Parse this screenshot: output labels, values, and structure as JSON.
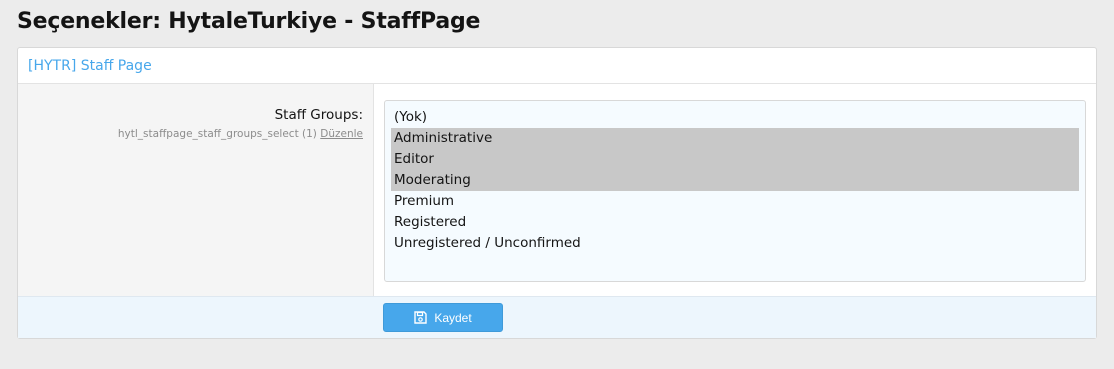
{
  "page": {
    "title": "Seçenekler: HytaleTurkiye - StaffPage"
  },
  "block": {
    "header_title": "[HYTR] Staff Page"
  },
  "field": {
    "label": "Staff Groups:",
    "hint_id": "hytl_staffpage_staff_groups_select (1)",
    "hint_edit_link": "Düzenle"
  },
  "select": {
    "options": [
      {
        "label": "(Yok)",
        "selected": false
      },
      {
        "label": "Administrative",
        "selected": true
      },
      {
        "label": "Editor",
        "selected": true
      },
      {
        "label": "Moderating",
        "selected": true
      },
      {
        "label": "Premium",
        "selected": false
      },
      {
        "label": "Registered",
        "selected": false
      },
      {
        "label": "Unregistered / Unconfirmed",
        "selected": false
      }
    ]
  },
  "footer": {
    "save_label": "Kaydet",
    "save_icon": "save-icon"
  },
  "colors": {
    "accent": "#47a7eb",
    "selected_option_bg": "#c8c8c8",
    "footer_bg": "#edf6fd"
  }
}
